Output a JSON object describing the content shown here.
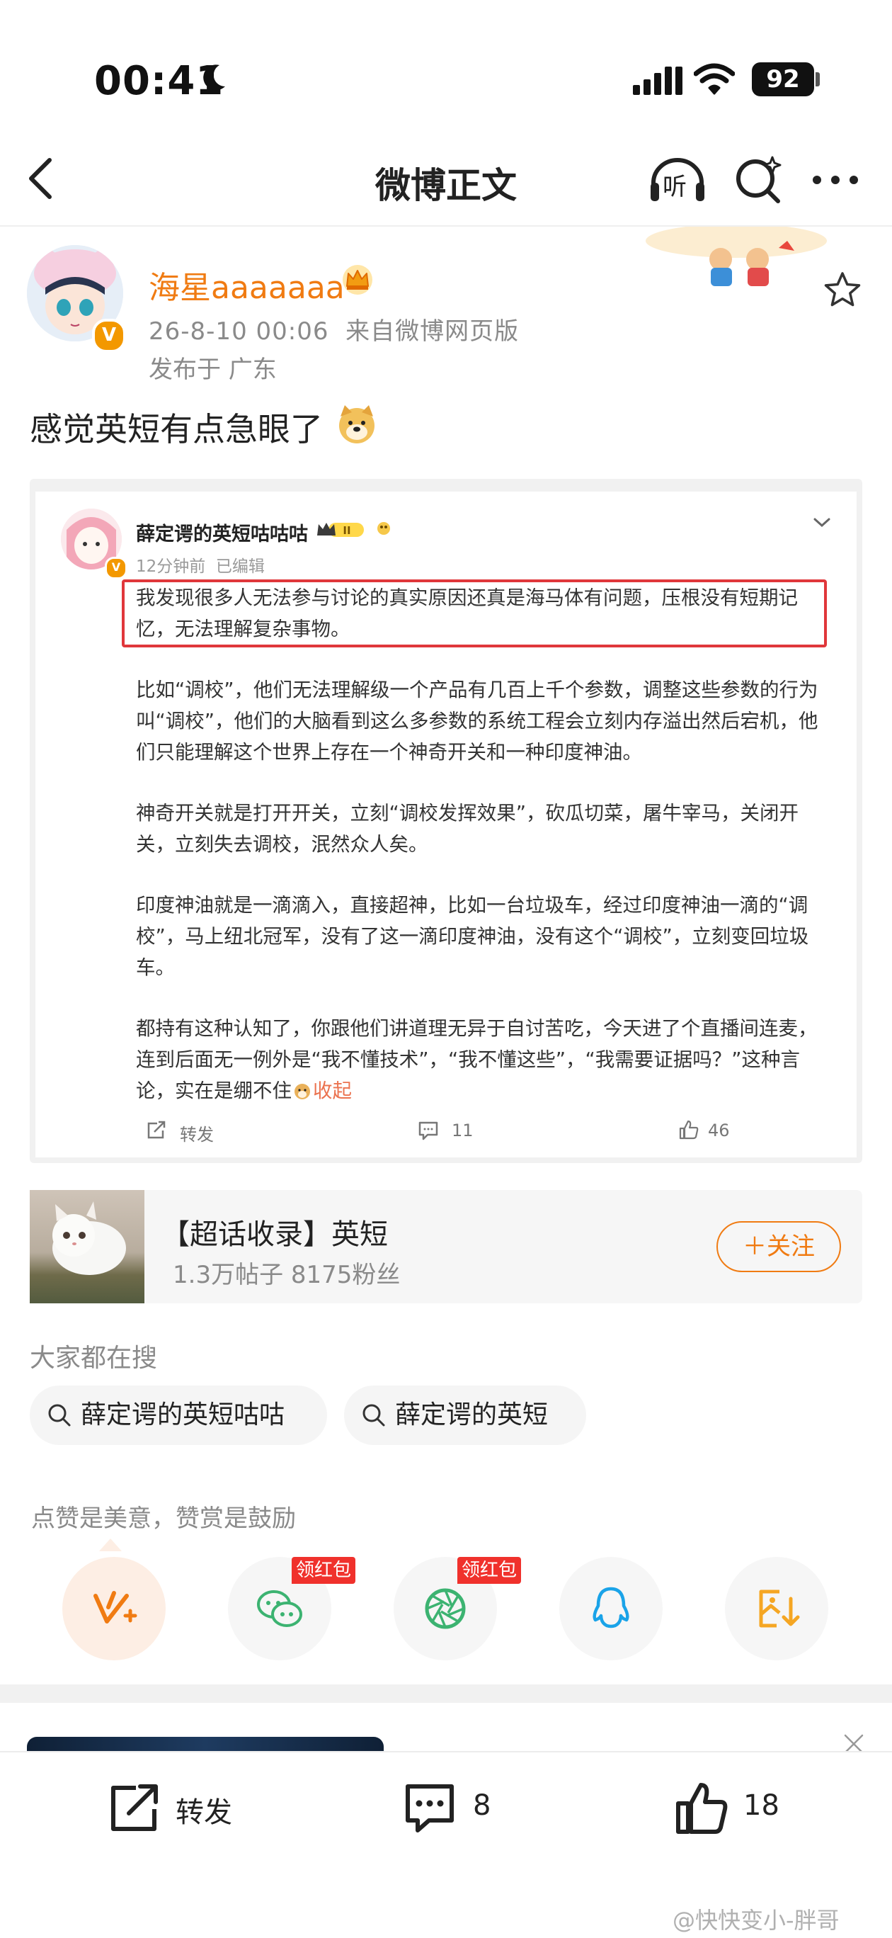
{
  "status_bar": {
    "time": "00:41",
    "battery": "92"
  },
  "nav": {
    "title": "微博正文",
    "listen_label": "听"
  },
  "post": {
    "username": "海星aaaaaaa",
    "timestamp": "26-8-10 00:06",
    "source": "来自微博网页版",
    "location": "发布于 广东",
    "text": "感觉英短有点急眼了"
  },
  "embedded": {
    "username": "薛定谔的英短咕咕咕",
    "level": "II",
    "meta": "12分钟前  已编辑",
    "highlighted": "我发现很多人无法参与讨论的真实原因还真是海马体有问题，压根没有短期记忆，无法理解复杂事物。",
    "para1": "比如“调校”，他们无法理解级一个产品有几百上千个参数，调整这些参数的行为叫“调校”，他们的大脑看到这么多参数的系统工程会立刻内存溢出然后宕机，他们只能理解这个世界上存在一个神奇开关和一种印度神油。",
    "para2": "神奇开关就是打开开关，立刻“调校发挥效果”，砍瓜切菜，屠牛宰马，关闭开关，立刻失去调校，泯然众人矣。",
    "para3": "印度神油就是一滴滴入，直接超神，比如一台垃圾车，经过印度神油一滴的“调校”，马上纽北冠军，没有了这一滴印度神油，没有这个“调校”，立刻变回垃圾车。",
    "para4": "都持有这种认知了，你跟他们讲道理无异于自讨苦吃，今天进了个直播间连麦，连到后面无一例外是“我不懂技术”，“我不懂这些”，“我需要证据吗？”这种言论，实在是绷不住",
    "collapse": "收起",
    "repost_label": "转发",
    "comments": "11",
    "likes": "46"
  },
  "topic": {
    "title": "【超话收录】英短",
    "stats": "1.3万帖子 8175粉丝",
    "follow_label": "＋关注"
  },
  "search": {
    "heading": "大家都在搜",
    "chips": [
      "薛定谔的英短咕咕",
      "薛定谔的英短"
    ]
  },
  "like_hint": "点赞是美意，赞赏是鼓励",
  "share": {
    "red_tag": "领红包"
  },
  "bottom_bar": {
    "repost_label": "转发",
    "comment_count": "8",
    "like_count": "18"
  },
  "watermark": "@快快变小-胖哥",
  "colors": {
    "accent": "#f07b12",
    "highlight_box": "#e0373b",
    "wechat_green": "#3cb371",
    "qq_blue": "#1aa3e8",
    "red_tag": "#f0312c"
  }
}
